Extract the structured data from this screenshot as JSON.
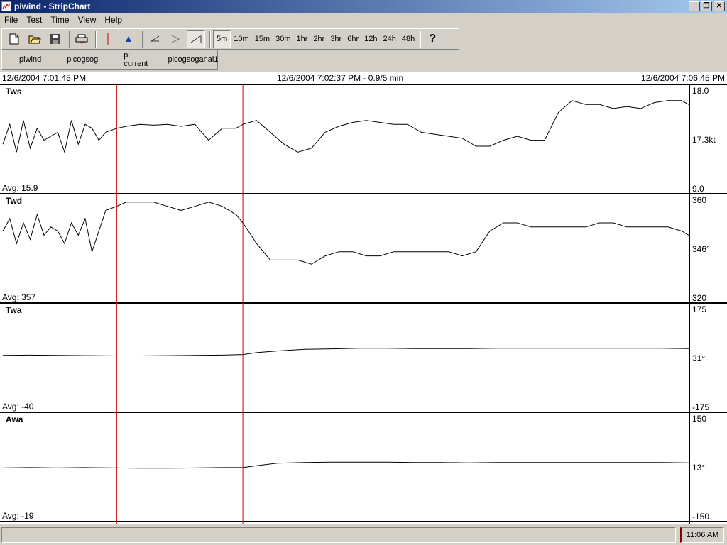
{
  "window": {
    "title": "piwind - StripChart"
  },
  "menu": [
    "File",
    "Test",
    "Time",
    "View",
    "Help"
  ],
  "toolbar": {
    "icons": [
      "new-file-icon",
      "open-folder-icon",
      "save-icon",
      "print-icon",
      "red-cursor-icon",
      "blue-marker-icon",
      "scroll-left-icon",
      "play-icon",
      "scroll-end-icon"
    ],
    "ranges": [
      "5m",
      "10m",
      "15m",
      "30m",
      "1hr",
      "2hr",
      "3hr",
      "6hr",
      "12h",
      "24h",
      "48h"
    ],
    "active_range": "5m",
    "help_label": "?"
  },
  "tabs": [
    "piwind",
    "picogsog",
    "pi current",
    "picogsoganal1"
  ],
  "timebar": {
    "left": "12/6/2004 7:01:45 PM",
    "center": "12/6/2004 7:02:37 PM - 0.9/5 min",
    "right": "12/6/2004 7:06:45 PM"
  },
  "status": {
    "clock": "11:06 AM"
  },
  "chart_data": {
    "type": "line",
    "x_range_minutes": [
      0,
      5
    ],
    "cursor_positions_minutes": [
      0.83,
      1.75
    ],
    "panels": [
      {
        "name": "Tws",
        "avg": "Avg: 15.9",
        "top": "18.0",
        "mid": "17.3kt",
        "bottom": "9.0",
        "ylim": [
          15.8,
          18.2
        ],
        "points": [
          [
            0,
            16.8
          ],
          [
            0.05,
            17.3
          ],
          [
            0.1,
            16.6
          ],
          [
            0.15,
            17.4
          ],
          [
            0.2,
            16.7
          ],
          [
            0.25,
            17.2
          ],
          [
            0.3,
            16.9
          ],
          [
            0.35,
            17.0
          ],
          [
            0.4,
            17.1
          ],
          [
            0.45,
            16.6
          ],
          [
            0.5,
            17.4
          ],
          [
            0.55,
            16.8
          ],
          [
            0.6,
            17.3
          ],
          [
            0.65,
            17.2
          ],
          [
            0.7,
            16.9
          ],
          [
            0.75,
            17.1
          ],
          [
            0.83,
            17.2
          ],
          [
            0.9,
            17.25
          ],
          [
            1.0,
            17.3
          ],
          [
            1.1,
            17.28
          ],
          [
            1.2,
            17.3
          ],
          [
            1.3,
            17.25
          ],
          [
            1.4,
            17.3
          ],
          [
            1.5,
            16.9
          ],
          [
            1.6,
            17.2
          ],
          [
            1.7,
            17.2
          ],
          [
            1.75,
            17.3
          ],
          [
            1.85,
            17.4
          ],
          [
            1.95,
            17.1
          ],
          [
            2.05,
            16.8
          ],
          [
            2.15,
            16.6
          ],
          [
            2.25,
            16.7
          ],
          [
            2.35,
            17.1
          ],
          [
            2.45,
            17.25
          ],
          [
            2.55,
            17.35
          ],
          [
            2.65,
            17.4
          ],
          [
            2.75,
            17.35
          ],
          [
            2.85,
            17.3
          ],
          [
            2.95,
            17.3
          ],
          [
            3.05,
            17.1
          ],
          [
            3.15,
            17.05
          ],
          [
            3.25,
            17.0
          ],
          [
            3.35,
            16.95
          ],
          [
            3.45,
            16.75
          ],
          [
            3.55,
            16.75
          ],
          [
            3.65,
            16.9
          ],
          [
            3.75,
            17.0
          ],
          [
            3.85,
            16.9
          ],
          [
            3.95,
            16.9
          ],
          [
            4.05,
            17.6
          ],
          [
            4.15,
            17.9
          ],
          [
            4.25,
            17.8
          ],
          [
            4.35,
            17.8
          ],
          [
            4.45,
            17.7
          ],
          [
            4.55,
            17.75
          ],
          [
            4.65,
            17.7
          ],
          [
            4.75,
            17.85
          ],
          [
            4.85,
            17.9
          ],
          [
            4.95,
            17.9
          ],
          [
            5.0,
            17.8
          ]
        ]
      },
      {
        "name": "Twd",
        "avg": "Avg: 357",
        "top": "360",
        "mid": "346°",
        "bottom": "320",
        "ylim": [
          340,
          363
        ],
        "points": [
          [
            0,
            355
          ],
          [
            0.05,
            358
          ],
          [
            0.1,
            352
          ],
          [
            0.15,
            357
          ],
          [
            0.2,
            353
          ],
          [
            0.25,
            359
          ],
          [
            0.3,
            354
          ],
          [
            0.35,
            356
          ],
          [
            0.4,
            355
          ],
          [
            0.45,
            352
          ],
          [
            0.5,
            357
          ],
          [
            0.55,
            354
          ],
          [
            0.6,
            358
          ],
          [
            0.65,
            350
          ],
          [
            0.7,
            355
          ],
          [
            0.75,
            360
          ],
          [
            0.83,
            361
          ],
          [
            0.9,
            362
          ],
          [
            1.0,
            362
          ],
          [
            1.1,
            362
          ],
          [
            1.2,
            361
          ],
          [
            1.3,
            360
          ],
          [
            1.4,
            361
          ],
          [
            1.5,
            362
          ],
          [
            1.6,
            361
          ],
          [
            1.7,
            359
          ],
          [
            1.75,
            357
          ],
          [
            1.85,
            352
          ],
          [
            1.95,
            348
          ],
          [
            2.05,
            348
          ],
          [
            2.15,
            348
          ],
          [
            2.25,
            347
          ],
          [
            2.35,
            349
          ],
          [
            2.45,
            350
          ],
          [
            2.55,
            350
          ],
          [
            2.65,
            349
          ],
          [
            2.75,
            349
          ],
          [
            2.85,
            350
          ],
          [
            2.95,
            350
          ],
          [
            3.05,
            350
          ],
          [
            3.15,
            350
          ],
          [
            3.25,
            350
          ],
          [
            3.35,
            349
          ],
          [
            3.45,
            350
          ],
          [
            3.55,
            355
          ],
          [
            3.65,
            357
          ],
          [
            3.75,
            357
          ],
          [
            3.85,
            356
          ],
          [
            3.95,
            356
          ],
          [
            4.05,
            356
          ],
          [
            4.15,
            356
          ],
          [
            4.25,
            356
          ],
          [
            4.35,
            357
          ],
          [
            4.45,
            357
          ],
          [
            4.55,
            356
          ],
          [
            4.65,
            356
          ],
          [
            4.75,
            356
          ],
          [
            4.85,
            356
          ],
          [
            4.95,
            355
          ],
          [
            5.0,
            354
          ]
        ]
      },
      {
        "name": "Twa",
        "avg": "Avg: -40",
        "top": "175",
        "mid": "31°",
        "bottom": "-175",
        "ylim": [
          -175,
          175
        ],
        "points": [
          [
            0,
            -2
          ],
          [
            0.2,
            -1
          ],
          [
            0.4,
            -2
          ],
          [
            0.6,
            -3
          ],
          [
            0.83,
            -4
          ],
          [
            1.0,
            -4
          ],
          [
            1.2,
            -3
          ],
          [
            1.4,
            -2
          ],
          [
            1.6,
            -1
          ],
          [
            1.75,
            1
          ],
          [
            1.85,
            8
          ],
          [
            2.0,
            14
          ],
          [
            2.2,
            20
          ],
          [
            2.4,
            22
          ],
          [
            2.6,
            24
          ],
          [
            2.8,
            24
          ],
          [
            3.0,
            23
          ],
          [
            3.2,
            23
          ],
          [
            3.4,
            23
          ],
          [
            3.6,
            24
          ],
          [
            3.8,
            24
          ],
          [
            4.0,
            24
          ],
          [
            4.2,
            24
          ],
          [
            4.4,
            24
          ],
          [
            4.6,
            24
          ],
          [
            4.8,
            24
          ],
          [
            5.0,
            23
          ]
        ]
      },
      {
        "name": "Awa",
        "avg": "Avg: -19",
        "top": "150",
        "mid": "13°",
        "bottom": "-150",
        "ylim": [
          -150,
          150
        ],
        "points": [
          [
            0,
            -12
          ],
          [
            0.2,
            -11
          ],
          [
            0.4,
            -12
          ],
          [
            0.6,
            -11
          ],
          [
            0.83,
            -12
          ],
          [
            1.0,
            -13
          ],
          [
            1.2,
            -13
          ],
          [
            1.4,
            -12
          ],
          [
            1.6,
            -11
          ],
          [
            1.75,
            -11
          ],
          [
            1.85,
            -5
          ],
          [
            2.0,
            3
          ],
          [
            2.2,
            5
          ],
          [
            2.4,
            6
          ],
          [
            2.6,
            6
          ],
          [
            2.8,
            6
          ],
          [
            3.0,
            5
          ],
          [
            3.2,
            5
          ],
          [
            3.4,
            4
          ],
          [
            3.6,
            5
          ],
          [
            3.8,
            5
          ],
          [
            4.0,
            5
          ],
          [
            4.2,
            5
          ],
          [
            4.4,
            5
          ],
          [
            4.6,
            5
          ],
          [
            4.8,
            5
          ],
          [
            5.0,
            4
          ]
        ]
      }
    ]
  }
}
